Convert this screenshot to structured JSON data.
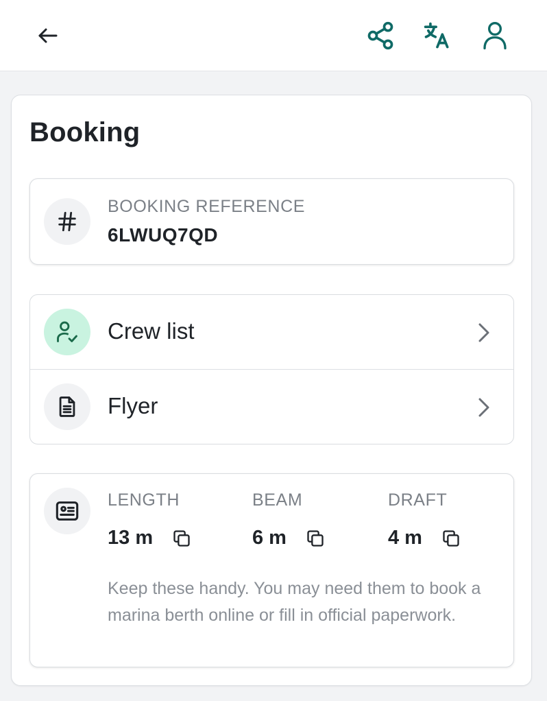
{
  "header": {
    "icons": {
      "back": "arrow-left-icon",
      "share": "share-icon",
      "translate": "translate-icon",
      "profile": "user-icon"
    }
  },
  "colors": {
    "accent": "#0f6a66",
    "crew_circle_bg": "#c9f3e0",
    "crew_icon": "#1a6a4a"
  },
  "booking": {
    "title": "Booking",
    "reference": {
      "icon": "hash-icon",
      "label": "BOOKING REFERENCE",
      "value": "6LWUQ7QD"
    },
    "links": [
      {
        "label": "Crew list",
        "icon": "user-check-icon"
      },
      {
        "label": "Flyer",
        "icon": "document-icon"
      }
    ],
    "dimensions": {
      "icon": "id-card-icon",
      "items": [
        {
          "label": "LENGTH",
          "value": "13 m"
        },
        {
          "label": "BEAM",
          "value": "6 m"
        },
        {
          "label": "DRAFT",
          "value": "4 m"
        }
      ],
      "hint": "Keep these handy. You may need them to book a marina berth online or fill in official paperwork."
    }
  }
}
